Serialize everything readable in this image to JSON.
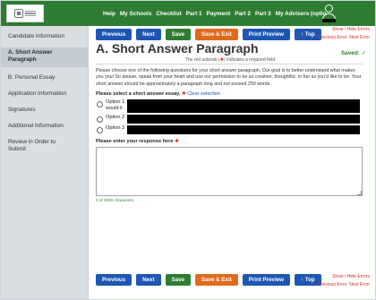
{
  "nav": {
    "items": [
      "Help",
      "My Schools",
      "Checklist",
      "Part 1",
      "Payment",
      "Part 2",
      "Part 3",
      "My Advisers (optio"
    ]
  },
  "sidebar": {
    "items": [
      {
        "label": "Candidate Information",
        "active": false
      },
      {
        "label": "A. Short Answer Paragraph",
        "active": true
      },
      {
        "label": "B. Personal Essay",
        "active": false
      },
      {
        "label": "Application Information",
        "active": false
      },
      {
        "label": "Signatures",
        "active": false
      },
      {
        "label": "Additional Information",
        "active": false
      },
      {
        "label": "Review in Order to Submit",
        "active": false
      }
    ]
  },
  "toolbar": {
    "previous": "Previous",
    "next": "Next",
    "save": "Save",
    "save_exit": "Save & Exit",
    "print_preview": "Print Preview",
    "top": "↑ Top"
  },
  "errors": {
    "show_hide": "Show / Hide Errors",
    "previous_error": "Previous Error",
    "next_error": "Next Error"
  },
  "main": {
    "title": "A. Short Answer Paragraph",
    "saved": "Saved: ✓",
    "required_note_pre": "The red asterisk (",
    "required_note_star": "✱",
    "required_note_post": ") indicates a required field",
    "instructions": "Please choose one of the following questions for your short answer paragraph. Our goal is to better understand what makes you you! So please, speak from your heart and use our permission to be as creative, thoughtful, or fun as you'd like to be. Your short answer should be approximately a paragraph long and not exceed 250 words.",
    "question_label": "Please select a short answer essay.",
    "required_star": "✱",
    "clear_selection": "Clear selection",
    "options": [
      {
        "label": "Option 1 would li"
      },
      {
        "label": "Option 2"
      },
      {
        "label": "Option 3"
      }
    ],
    "response_label": "Please enter your response here",
    "response_value": "",
    "counter": "0 of 3000 characters"
  },
  "colors": {
    "header_green": "#2e7d32",
    "button_blue": "#1e56b3",
    "button_orange": "#e06b1c",
    "error_red": "#d93025"
  }
}
